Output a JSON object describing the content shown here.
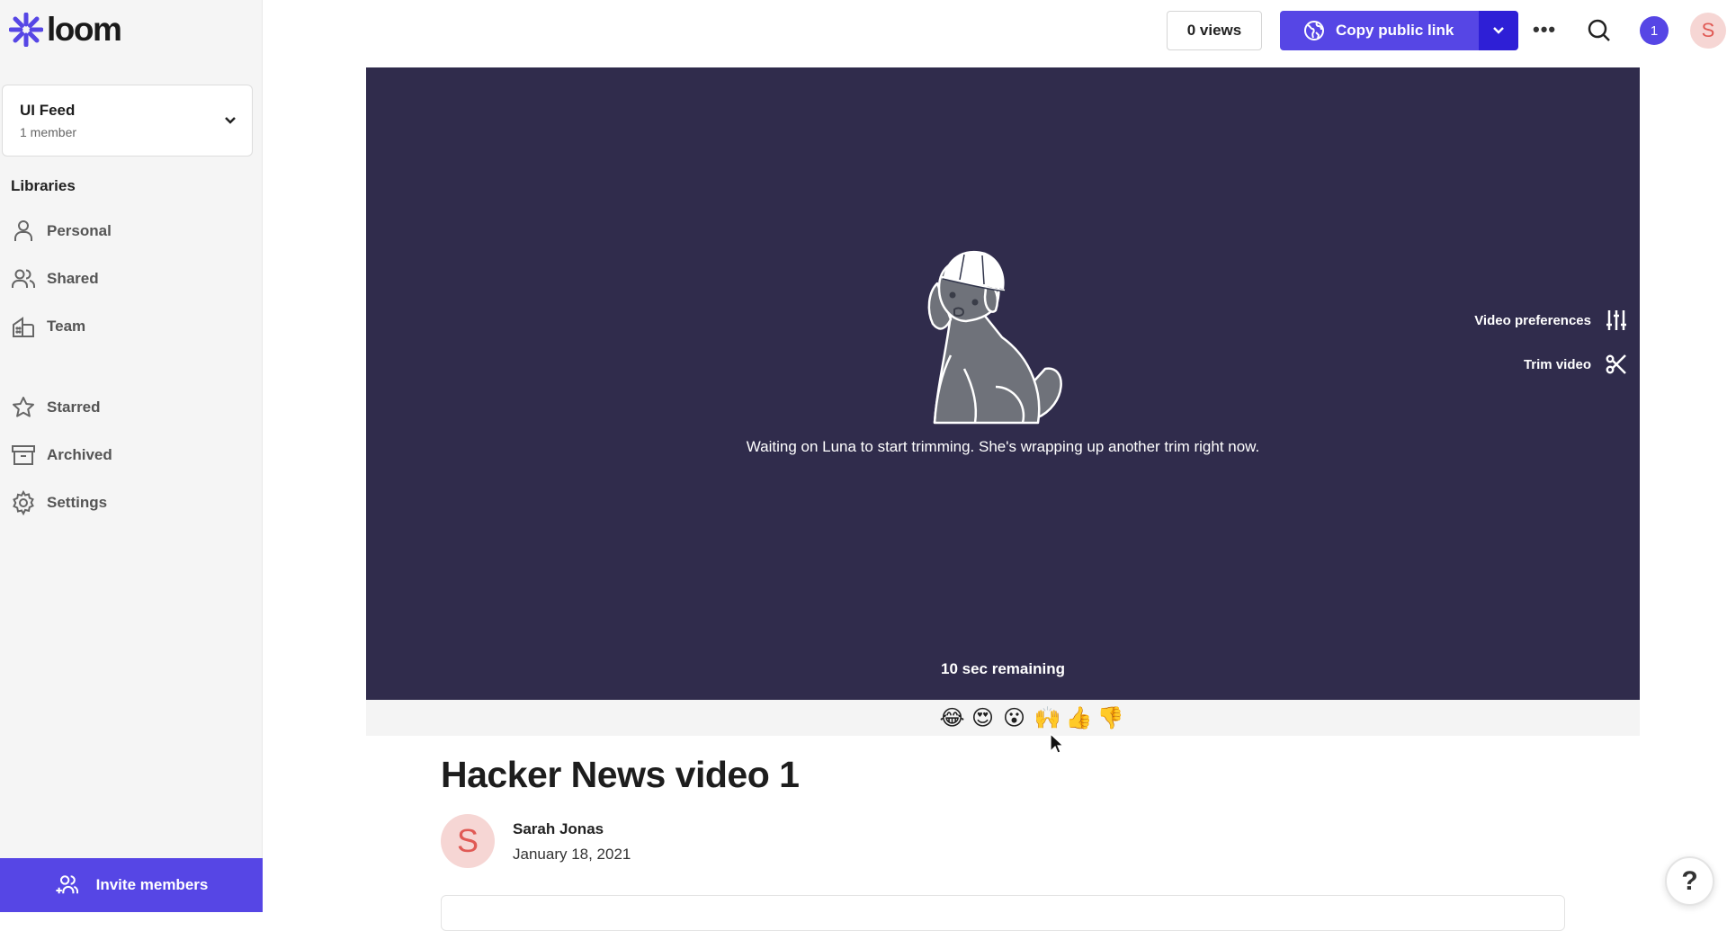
{
  "brand": {
    "name": "loom",
    "color": "#5646e5"
  },
  "workspace": {
    "name": "UI Feed",
    "members": "1 member"
  },
  "sidebar": {
    "section_label": "Libraries",
    "items": [
      {
        "label": "Personal",
        "icon": "person-icon"
      },
      {
        "label": "Shared",
        "icon": "people-icon"
      },
      {
        "label": "Team",
        "icon": "building-icon"
      },
      {
        "label": "Starred",
        "icon": "star-icon"
      },
      {
        "label": "Archived",
        "icon": "archive-icon"
      },
      {
        "label": "Settings",
        "icon": "gear-icon"
      }
    ],
    "invite_label": "Invite members"
  },
  "header": {
    "views": "0 views",
    "copy_link": "Copy public link",
    "notifications": "1",
    "user_initial": "S"
  },
  "video": {
    "status_message": "Waiting on Luna to start trimming. She's wrapping up another trim right now.",
    "remaining": "10 sec remaining",
    "preferences_label": "Video preferences",
    "trim_label": "Trim video"
  },
  "reactions": [
    "😂",
    "😍",
    "😮",
    "🙌",
    "👍",
    "👎"
  ],
  "details": {
    "title": "Hacker News video 1",
    "author": "Sarah Jonas",
    "author_initial": "S",
    "date": "January 18, 2021"
  },
  "help_label": "?"
}
